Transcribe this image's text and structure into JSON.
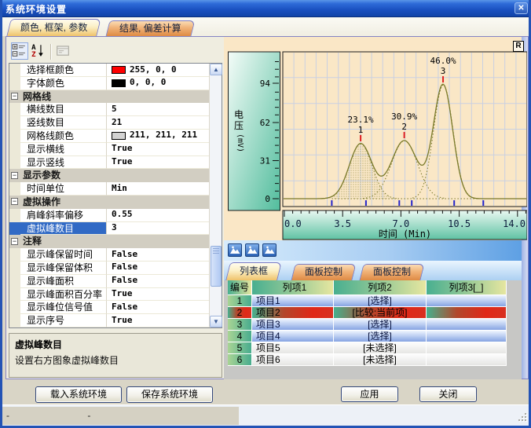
{
  "window": {
    "title": "系统环境设置"
  },
  "icons": {
    "close": "✕",
    "reset": "R",
    "collapse": "−"
  },
  "main_tabs": [
    {
      "label": "颜色, 框架, 参数",
      "active": true
    },
    {
      "label": "结果, 偏差计算",
      "active": false
    }
  ],
  "property_grid": {
    "rows": [
      {
        "type": "item",
        "label": "选择框颜色",
        "value": "255, 0, 0",
        "swatch": "#FF0000"
      },
      {
        "type": "item",
        "label": "字体颜色",
        "value": "0, 0, 0",
        "swatch": "#000000"
      },
      {
        "type": "category",
        "label": "网格线"
      },
      {
        "type": "item",
        "label": "横线数目",
        "value": "5"
      },
      {
        "type": "item",
        "label": "竖线数目",
        "value": "21"
      },
      {
        "type": "item",
        "label": "网格线颜色",
        "value": "211, 211, 211",
        "swatch": "#D3D3D3"
      },
      {
        "type": "item",
        "label": "显示横线",
        "value": "True"
      },
      {
        "type": "item",
        "label": "显示竖线",
        "value": "True"
      },
      {
        "type": "category",
        "label": "显示参数"
      },
      {
        "type": "item",
        "label": "时间单位",
        "value": "Min"
      },
      {
        "type": "category",
        "label": "虚拟操作"
      },
      {
        "type": "item",
        "label": "肩峰斜率偏移",
        "value": "0.55"
      },
      {
        "type": "item",
        "label": "虚拟峰数目",
        "value": "3",
        "selected": true
      },
      {
        "type": "category",
        "label": "注释"
      },
      {
        "type": "item",
        "label": "显示峰保留时间",
        "value": "False"
      },
      {
        "type": "item",
        "label": "显示峰保留体积",
        "value": "False"
      },
      {
        "type": "item",
        "label": "显示峰面积",
        "value": "False"
      },
      {
        "type": "item",
        "label": "显示峰面积百分率",
        "value": "True"
      },
      {
        "type": "item",
        "label": "显示峰位信号值",
        "value": "False"
      },
      {
        "type": "item",
        "label": "显示序号",
        "value": "True"
      }
    ]
  },
  "description": {
    "title": "虚拟峰数目",
    "text": "设置右方图象虚拟峰数目"
  },
  "chart_data": {
    "type": "line",
    "title": "",
    "ylabel_cn": "电压",
    "ylabel_unit": "(mV)",
    "xlabel": "时间 (Min)",
    "xlim": [
      0,
      14.5
    ],
    "ylim": [
      0,
      126
    ],
    "x_major_ticks": [
      0,
      3.5,
      7,
      10.5,
      14
    ],
    "x_tick_labels": [
      "0.0",
      "3.5",
      "7.0",
      "10.5",
      "14.0"
    ],
    "x_minor_step": 0.5,
    "y_major_ticks": [
      0,
      31,
      62,
      94
    ],
    "y_minor_step": 6.2,
    "grid": {
      "h_lines": 5,
      "v_lines": 21,
      "color": "#C9D0E2"
    },
    "plot_bg": "#FAE7C6",
    "curve_color": "#7A7A2A",
    "peak_tick_color": "#E02020",
    "marker_color": "#2323CC",
    "peaks": [
      {
        "index": "1",
        "time_min": 4.58,
        "height_mV": 44.8,
        "sigma_min": 0.68,
        "area_percent": "23.1%",
        "filled": true
      },
      {
        "index": "2",
        "time_min": 7.2,
        "height_mV": 47.3,
        "sigma_min": 0.78,
        "area_percent": "30.9%",
        "filled": false
      },
      {
        "index": "3",
        "time_min": 9.53,
        "height_mV": 92.7,
        "sigma_min": 0.58,
        "area_percent": "46.0%",
        "filled": false
      }
    ],
    "baseline_markers_min": [
      2.85,
      4.9,
      6.9,
      7.65,
      10.2,
      11.95
    ]
  },
  "panel_tabs": [
    {
      "label": "列表框",
      "active": true
    },
    {
      "label": "面板控制",
      "active": false
    },
    {
      "label": "面板控制",
      "active": false
    }
  ],
  "table": {
    "columns": [
      "编号",
      "列项1",
      "列项2",
      "列项3[_]"
    ],
    "rows": [
      {
        "no": "1",
        "col1": "项目1",
        "col2": "[选择]",
        "col3": "",
        "style": "blue"
      },
      {
        "no": "2",
        "col1": "项目2",
        "col2": "[比较:当前项]",
        "col3": "",
        "style": "red"
      },
      {
        "no": "3",
        "col1": "项目3",
        "col2": "[选择]",
        "col3": "",
        "style": "blue"
      },
      {
        "no": "4",
        "col1": "项目4",
        "col2": "[选择]",
        "col3": "",
        "style": "blue"
      },
      {
        "no": "5",
        "col1": "项目5",
        "col2": "[未选择]",
        "col3": "",
        "style": "plain"
      },
      {
        "no": "6",
        "col1": "项目6",
        "col2": "[未选择]",
        "col3": "",
        "style": "plain"
      }
    ]
  },
  "buttons": {
    "load": "载入系统环境",
    "save": "保存系统环境",
    "apply": "应用",
    "close": "关闭"
  },
  "status": {
    "left": "-",
    "mid": "-"
  }
}
